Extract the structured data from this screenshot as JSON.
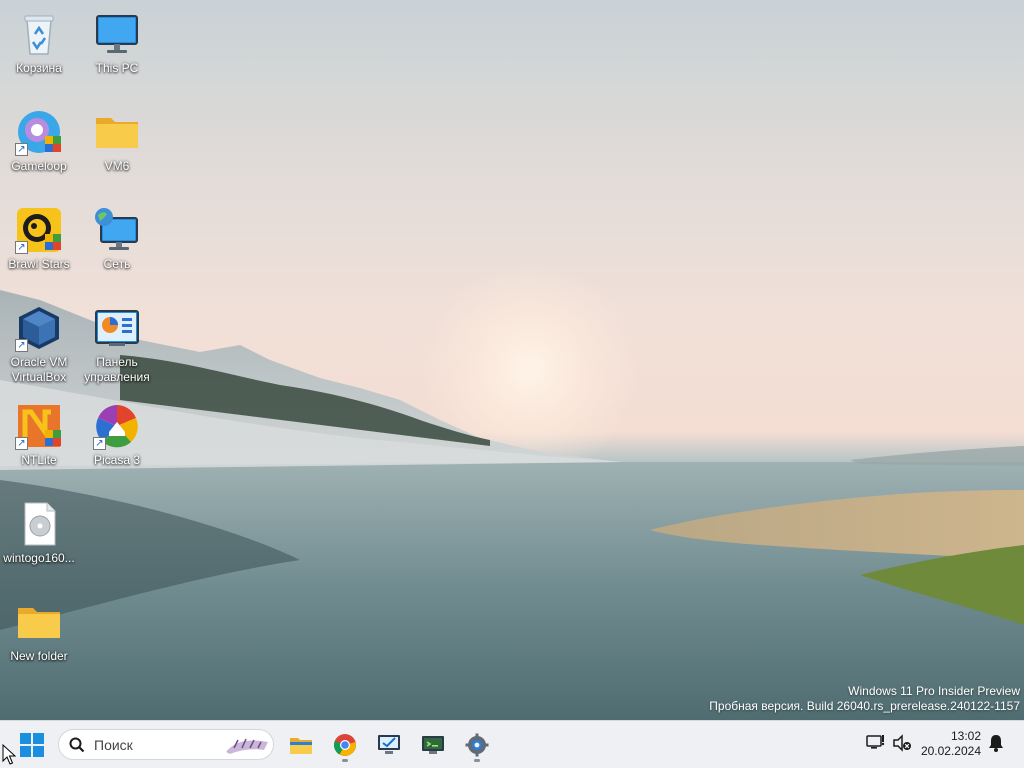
{
  "desktop": {
    "icons": [
      {
        "label": "Корзина",
        "icon": "recycle-bin-icon"
      },
      {
        "label": "This PC",
        "icon": "monitor-icon"
      },
      {
        "label": "Gameloop",
        "icon": "gameloop-icon",
        "shortcut": true
      },
      {
        "label": "VM6",
        "icon": "folder-icon"
      },
      {
        "label": "Brawl Stars",
        "icon": "brawl-stars-icon",
        "shortcut": true
      },
      {
        "label": "Сеть",
        "icon": "network-icon"
      },
      {
        "label": "Oracle VM VirtualBox",
        "icon": "virtualbox-icon",
        "shortcut": true
      },
      {
        "label": "Панель управления",
        "icon": "control-panel-icon"
      },
      {
        "label": "NTLite",
        "icon": "ntlite-icon",
        "shortcut": true
      },
      {
        "label": "Picasa 3",
        "icon": "picasa-icon",
        "shortcut": true
      },
      {
        "label": "wintogo160...",
        "icon": "disc-image-file-icon"
      },
      {
        "label": "New folder",
        "icon": "folder-icon"
      }
    ],
    "watermark": {
      "line1": "Windows 11 Pro Insider Preview",
      "line2": "Пробная версия. Build 26040.rs_prerelease.240122-1157"
    }
  },
  "taskbar": {
    "search_placeholder": "Поиск",
    "apps": [
      {
        "name": "file-explorer",
        "icon": "folder-icon",
        "running": false
      },
      {
        "name": "chrome",
        "icon": "chrome-icon",
        "running": true
      },
      {
        "name": "system-tool",
        "icon": "monitor-check-icon",
        "running": false
      },
      {
        "name": "task-manager",
        "icon": "monitor-terminal-icon",
        "running": false
      },
      {
        "name": "settings",
        "icon": "gear-icon",
        "running": true
      }
    ],
    "tray": {
      "time": "13:02",
      "date": "20.02.2024"
    }
  },
  "colors": {
    "taskbar_bg": "#eef0f3",
    "windows_blue": "#1a8fe0",
    "folder_yellow": "#f6c343"
  }
}
